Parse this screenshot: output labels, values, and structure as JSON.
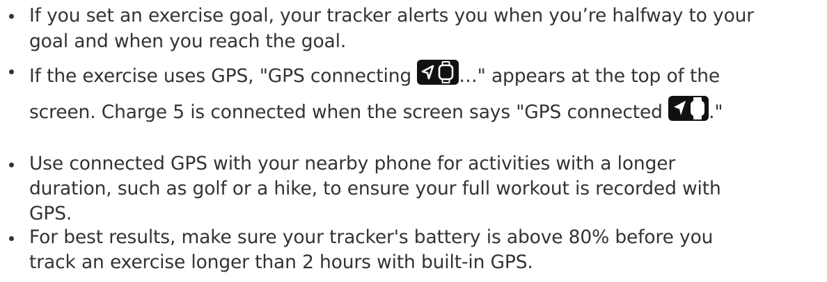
{
  "bullets": [
    {
      "lines": [
        "If you set an exercise goal, your tracker alerts you when you’re halfway to your",
        "goal and when you reach the goal."
      ]
    },
    {
      "line1_before_icon": "If the exercise uses GPS, \"GPS connecting ",
      "icon1": "gps-connecting-icon",
      "line1_after_icon": "…\" appears at the top of the",
      "line2_before_icon": "screen. Charge 5 is connected when the screen says \"GPS connected ",
      "icon2": "gps-connected-icon",
      "line2_after_icon": ".\""
    },
    {
      "lines": [
        "Use connected GPS with your nearby phone for activities with a longer",
        "duration, such as golf or a hike, to ensure your full workout is recorded with",
        "GPS."
      ]
    },
    {
      "lines": [
        "For best results, make sure your tracker's battery is above 80% before you",
        "track an exercise longer than 2 hours with built-in GPS."
      ]
    }
  ],
  "colors": {
    "text": "#333333",
    "icon_background": "#111111",
    "icon_foreground": "#ffffff"
  }
}
